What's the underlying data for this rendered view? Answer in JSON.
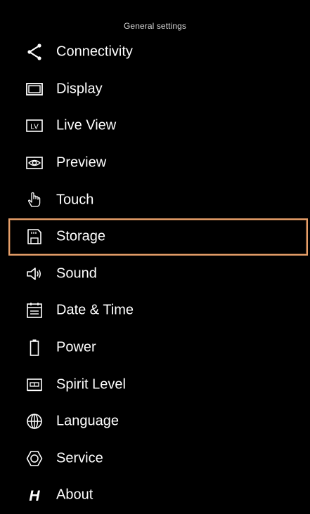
{
  "header": {
    "title": "General settings"
  },
  "menu": {
    "items": [
      {
        "label": "Connectivity",
        "icon": "share-icon"
      },
      {
        "label": "Display",
        "icon": "display-icon"
      },
      {
        "label": "Live View",
        "icon": "live-view-icon",
        "icon_text": "LV"
      },
      {
        "label": "Preview",
        "icon": "preview-eye-icon"
      },
      {
        "label": "Touch",
        "icon": "touch-hand-icon"
      },
      {
        "label": "Storage",
        "icon": "storage-card-icon",
        "selected": true
      },
      {
        "label": "Sound",
        "icon": "speaker-icon"
      },
      {
        "label": "Date & Time",
        "icon": "calendar-icon"
      },
      {
        "label": "Power",
        "icon": "battery-icon"
      },
      {
        "label": "Spirit Level",
        "icon": "spirit-level-icon"
      },
      {
        "label": "Language",
        "icon": "globe-icon"
      },
      {
        "label": "Service",
        "icon": "hexagon-icon"
      },
      {
        "label": "About",
        "icon": "hasselblad-logo-icon",
        "icon_text": "H"
      }
    ]
  },
  "colors": {
    "background": "#000000",
    "text": "#ffffff",
    "selection_border": "#e8a06a"
  }
}
